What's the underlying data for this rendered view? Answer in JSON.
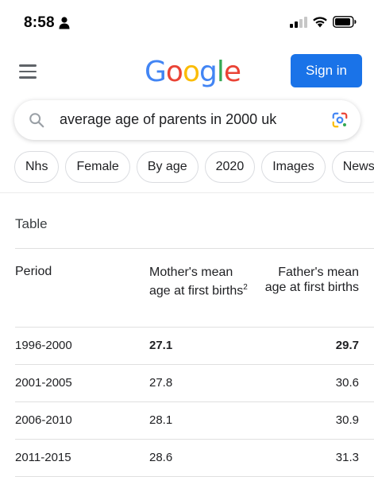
{
  "status_bar": {
    "time": "8:58"
  },
  "header": {
    "logo_letters": [
      {
        "ch": "G",
        "color": "#4285F4"
      },
      {
        "ch": "o",
        "color": "#EA4335"
      },
      {
        "ch": "o",
        "color": "#FBBC05"
      },
      {
        "ch": "g",
        "color": "#4285F4"
      },
      {
        "ch": "l",
        "color": "#34A853"
      },
      {
        "ch": "e",
        "color": "#EA4335"
      }
    ],
    "signin_label": "Sign in"
  },
  "search": {
    "query": "average age of parents in 2000 uk"
  },
  "chips": [
    "Nhs",
    "Female",
    "By age",
    "2020",
    "Images",
    "News"
  ],
  "table": {
    "title": "Table",
    "headers": {
      "period": "Period",
      "mother": "Mother's mean age at first births",
      "mother_sup": "2",
      "father": "Father's mean age at first births"
    },
    "rows": [
      {
        "period": "1996-2000",
        "mother": "27.1",
        "father": "29.7",
        "bold": true
      },
      {
        "period": "2001-2005",
        "mother": "27.8",
        "father": "30.6",
        "bold": false
      },
      {
        "period": "2006-2010",
        "mother": "28.1",
        "father": "30.9",
        "bold": false
      },
      {
        "period": "2011-2015",
        "mother": "28.6",
        "father": "31.3",
        "bold": false
      }
    ]
  }
}
